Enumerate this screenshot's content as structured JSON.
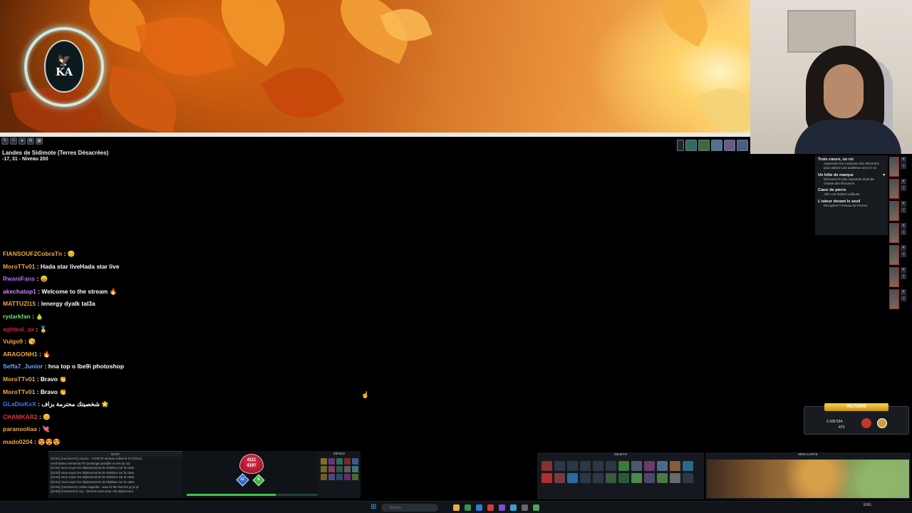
{
  "window": {
    "title": "",
    "map_name": "Landes de Sidimote (Terres Désacrées)",
    "coords_level": "-17, 31 - Niveau 200",
    "hud_percent": ""
  },
  "logo": {
    "initials": "KA",
    "subtitle": ""
  },
  "quests": [
    {
      "title": "Trois cœurs, un roi",
      "desc": "Apprendre les coutumes des Rhoorims pour obtenir une audience avec le roi"
    },
    {
      "title": "Un hôte de marque",
      "desc": "Découvrir le plus important rituel de chasse des Rhoorims"
    },
    {
      "title": "Cœur de pierre",
      "desc": "Aller voir Robert Lafleuse"
    },
    {
      "title": "L'odeur devant le seuil",
      "desc": "Récupérer l'Anneau de Pierres"
    }
  ],
  "stream_chat": [
    {
      "user": "FIANSOUF2CobraTn",
      "color": "#f2a93b",
      "text": "😊"
    },
    {
      "user": "MoroTTv01",
      "color": "#f2a93b",
      "text": "Hada star liveHada star live"
    },
    {
      "user": "RwaniFans",
      "color": "#b46cf0",
      "text": "😄"
    },
    {
      "user": "akechatop1",
      "color": "#c888ff",
      "text": "Welcome to the stream 🔥"
    },
    {
      "user": "MATTUZI15",
      "color": "#f2a93b",
      "text": "lenergy dyalk tal3a"
    },
    {
      "user": "rydarkfan",
      "color": "#6ee07a",
      "text": "🍐"
    },
    {
      "user": "aghteal_ax",
      "color": "#d61d3e",
      "text": "🥇"
    },
    {
      "user": "Vulgo9",
      "color": "#f2a93b",
      "text": "😘"
    },
    {
      "user": "ARAGONH1",
      "color": "#f2a93b",
      "text": "🔥"
    },
    {
      "user": "Seffa7_Junior",
      "color": "#6ea8ff",
      "text": "hna top o lbe9i photoshop"
    },
    {
      "user": "MoroTTv01",
      "color": "#f2a93b",
      "text": "Bravo 👏"
    },
    {
      "user": "MoroTTv01",
      "color": "#f2a93b",
      "text": "Bravo 👏"
    },
    {
      "user": "GLaDioKxX",
      "color": "#3a7cff",
      "text": "شخصيتك محترمة بزاف 🌟"
    },
    {
      "user": "CHAMKAR2",
      "color": "#e0323f",
      "text": "😊"
    },
    {
      "user": "paranooliaa",
      "color": "#f2a93b",
      "text": "💘"
    },
    {
      "user": "mado0204",
      "color": "#f2a93b",
      "text": "😍😍😍"
    }
  ],
  "hud": {
    "chat_header": "CHAT",
    "menus_header": "MENUS",
    "objets_header": "OBJETS",
    "minimap_header": "MINI-CARTE",
    "chat_log": [
      "[22:51] (Commerce) Linoree : ACHETE anneau volkorne FA (5%sc),",
      "vend bottes meriannia FO (echange possible vs 6% do so)",
      "[22:51] Vous voyez les déplacements de Diabloxx sur la carte.",
      "[22:53] Vous voyez les déplacements de Diabloxx sur la carte.",
      "[22:54] Vous voyez les déplacements de Diabloxx sur la carte.",
      "[22:54] Vous voyez les déplacements de Diabloxx sur la carte.",
      "[22:55] (Commerce) Ambre-iaquette : asso lvl 99 cherche gr pr pl",
      "[22:55] (Commerce) Yoy : cherche team pour Alis alignement"
    ],
    "hp_current": "4111",
    "hp_max": "4197",
    "ap": "12",
    "mp": "6",
    "xp_progress": 0.68
  },
  "victory": {
    "label": "VICTOIRE",
    "kamas": "2 439 534",
    "xp": "473"
  },
  "taskbar": {
    "search_placeholder": "Search",
    "tray": "ENG",
    "time": "",
    "date": ""
  }
}
